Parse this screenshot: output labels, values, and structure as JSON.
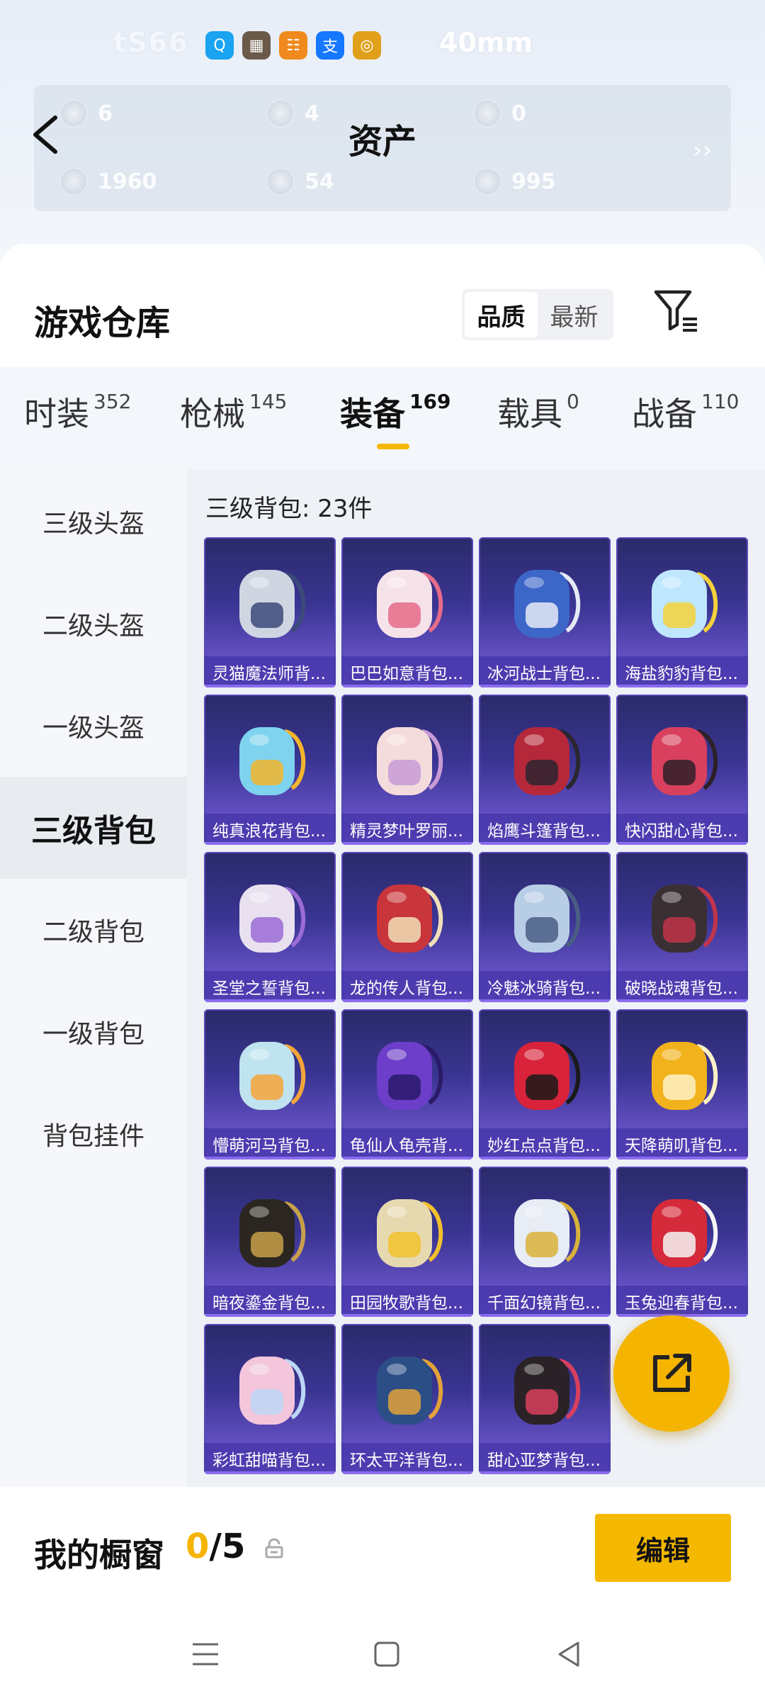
{
  "hero": {
    "names_left": "tS66",
    "names_right": "40mm",
    "apps": [
      {
        "name": "qq-icon",
        "color": "#1aa3f0",
        "glyph": "Q"
      },
      {
        "name": "game-avatar-icon",
        "color": "#6b5a4a",
        "glyph": "▦"
      },
      {
        "name": "store-icon",
        "color": "#f08a1e",
        "glyph": "☷"
      },
      {
        "name": "alipay-icon",
        "color": "#1677ff",
        "glyph": "支"
      },
      {
        "name": "target-icon",
        "color": "#e0a01a",
        "glyph": "◎"
      }
    ]
  },
  "assets": {
    "title": "资产",
    "cells": [
      {
        "value": "6"
      },
      {
        "value": "4"
      },
      {
        "value": "0"
      },
      {
        "value": "1960"
      },
      {
        "value": "54"
      },
      {
        "value": "995"
      }
    ]
  },
  "warehouse": {
    "title": "游戏仓库",
    "sort_quality": "品质",
    "sort_latest": "最新"
  },
  "tabs": [
    {
      "label": "时装",
      "count": "352"
    },
    {
      "label": "枪械",
      "count": "145"
    },
    {
      "label": "装备",
      "count": "169"
    },
    {
      "label": "载具",
      "count": "0"
    },
    {
      "label": "战备",
      "count": "110"
    }
  ],
  "sidebar": [
    {
      "label": "三级头盔"
    },
    {
      "label": "二级头盔"
    },
    {
      "label": "一级头盔"
    },
    {
      "label": "三级背包"
    },
    {
      "label": "二级背包"
    },
    {
      "label": "一级背包"
    },
    {
      "label": "背包挂件"
    }
  ],
  "section_label": "三级背包: 23件",
  "items": [
    {
      "name": "灵猫魔法师背...",
      "c1": "#cfd6e2",
      "c2": "#3b4a7a"
    },
    {
      "name": "巴巴如意背包...",
      "c1": "#f6e3ea",
      "c2": "#e56b8a"
    },
    {
      "name": "冰河战士背包...",
      "c1": "#3d66c9",
      "c2": "#e5eaf5"
    },
    {
      "name": "海盐豹豹背包...",
      "c1": "#bfe6ff",
      "c2": "#f5d13a"
    },
    {
      "name": "纯真浪花背包...",
      "c1": "#7fd3ef",
      "c2": "#f3b52b"
    },
    {
      "name": "精灵梦叶罗丽...",
      "c1": "#f4dcdc",
      "c2": "#c89bd6"
    },
    {
      "name": "焰鹰斗篷背包...",
      "c1": "#b5283a",
      "c2": "#2b2530"
    },
    {
      "name": "快闪甜心背包...",
      "c1": "#d9405e",
      "c2": "#2d2028"
    },
    {
      "name": "圣堂之誓背包...",
      "c1": "#e9e1f0",
      "c2": "#9b6bd6"
    },
    {
      "name": "龙的传人背包...",
      "c1": "#c8353a",
      "c2": "#f1dfb8"
    },
    {
      "name": "冷魅冰骑背包...",
      "c1": "#b8cde6",
      "c2": "#4a5d84"
    },
    {
      "name": "破晓战魂背包...",
      "c1": "#3a3033",
      "c2": "#c1344a"
    },
    {
      "name": "懵萌河马背包...",
      "c1": "#bfe3ef",
      "c2": "#f4a53a"
    },
    {
      "name": "龟仙人龟壳背...",
      "c1": "#6c3ec9",
      "c2": "#2a1a6a"
    },
    {
      "name": "妙红点点背包...",
      "c1": "#d8233a",
      "c2": "#1a1a1a"
    },
    {
      "name": "天降萌叽背包...",
      "c1": "#f2b21c",
      "c2": "#fff1c6"
    },
    {
      "name": "暗夜鎏金背包...",
      "c1": "#2b2620",
      "c2": "#c7a04a"
    },
    {
      "name": "田园牧歌背包...",
      "c1": "#e6d9b0",
      "c2": "#f1c12c"
    },
    {
      "name": "千面幻镜背包...",
      "c1": "#e7ecf5",
      "c2": "#d9b23a"
    },
    {
      "name": "玉兔迎春背包...",
      "c1": "#d52a3a",
      "c2": "#f5f5f5"
    },
    {
      "name": "彩虹甜喵背包...",
      "c1": "#f3c6dc",
      "c2": "#bcd6f5"
    },
    {
      "name": "环太平洋背包...",
      "c1": "#2c4e86",
      "c2": "#e2a23a"
    },
    {
      "name": "甜心亚梦背包...",
      "c1": "#2a2226",
      "c2": "#d9405e"
    }
  ],
  "showcase": {
    "title": "我的橱窗",
    "current": "0",
    "separator": "/5"
  },
  "edit_label": "编辑"
}
